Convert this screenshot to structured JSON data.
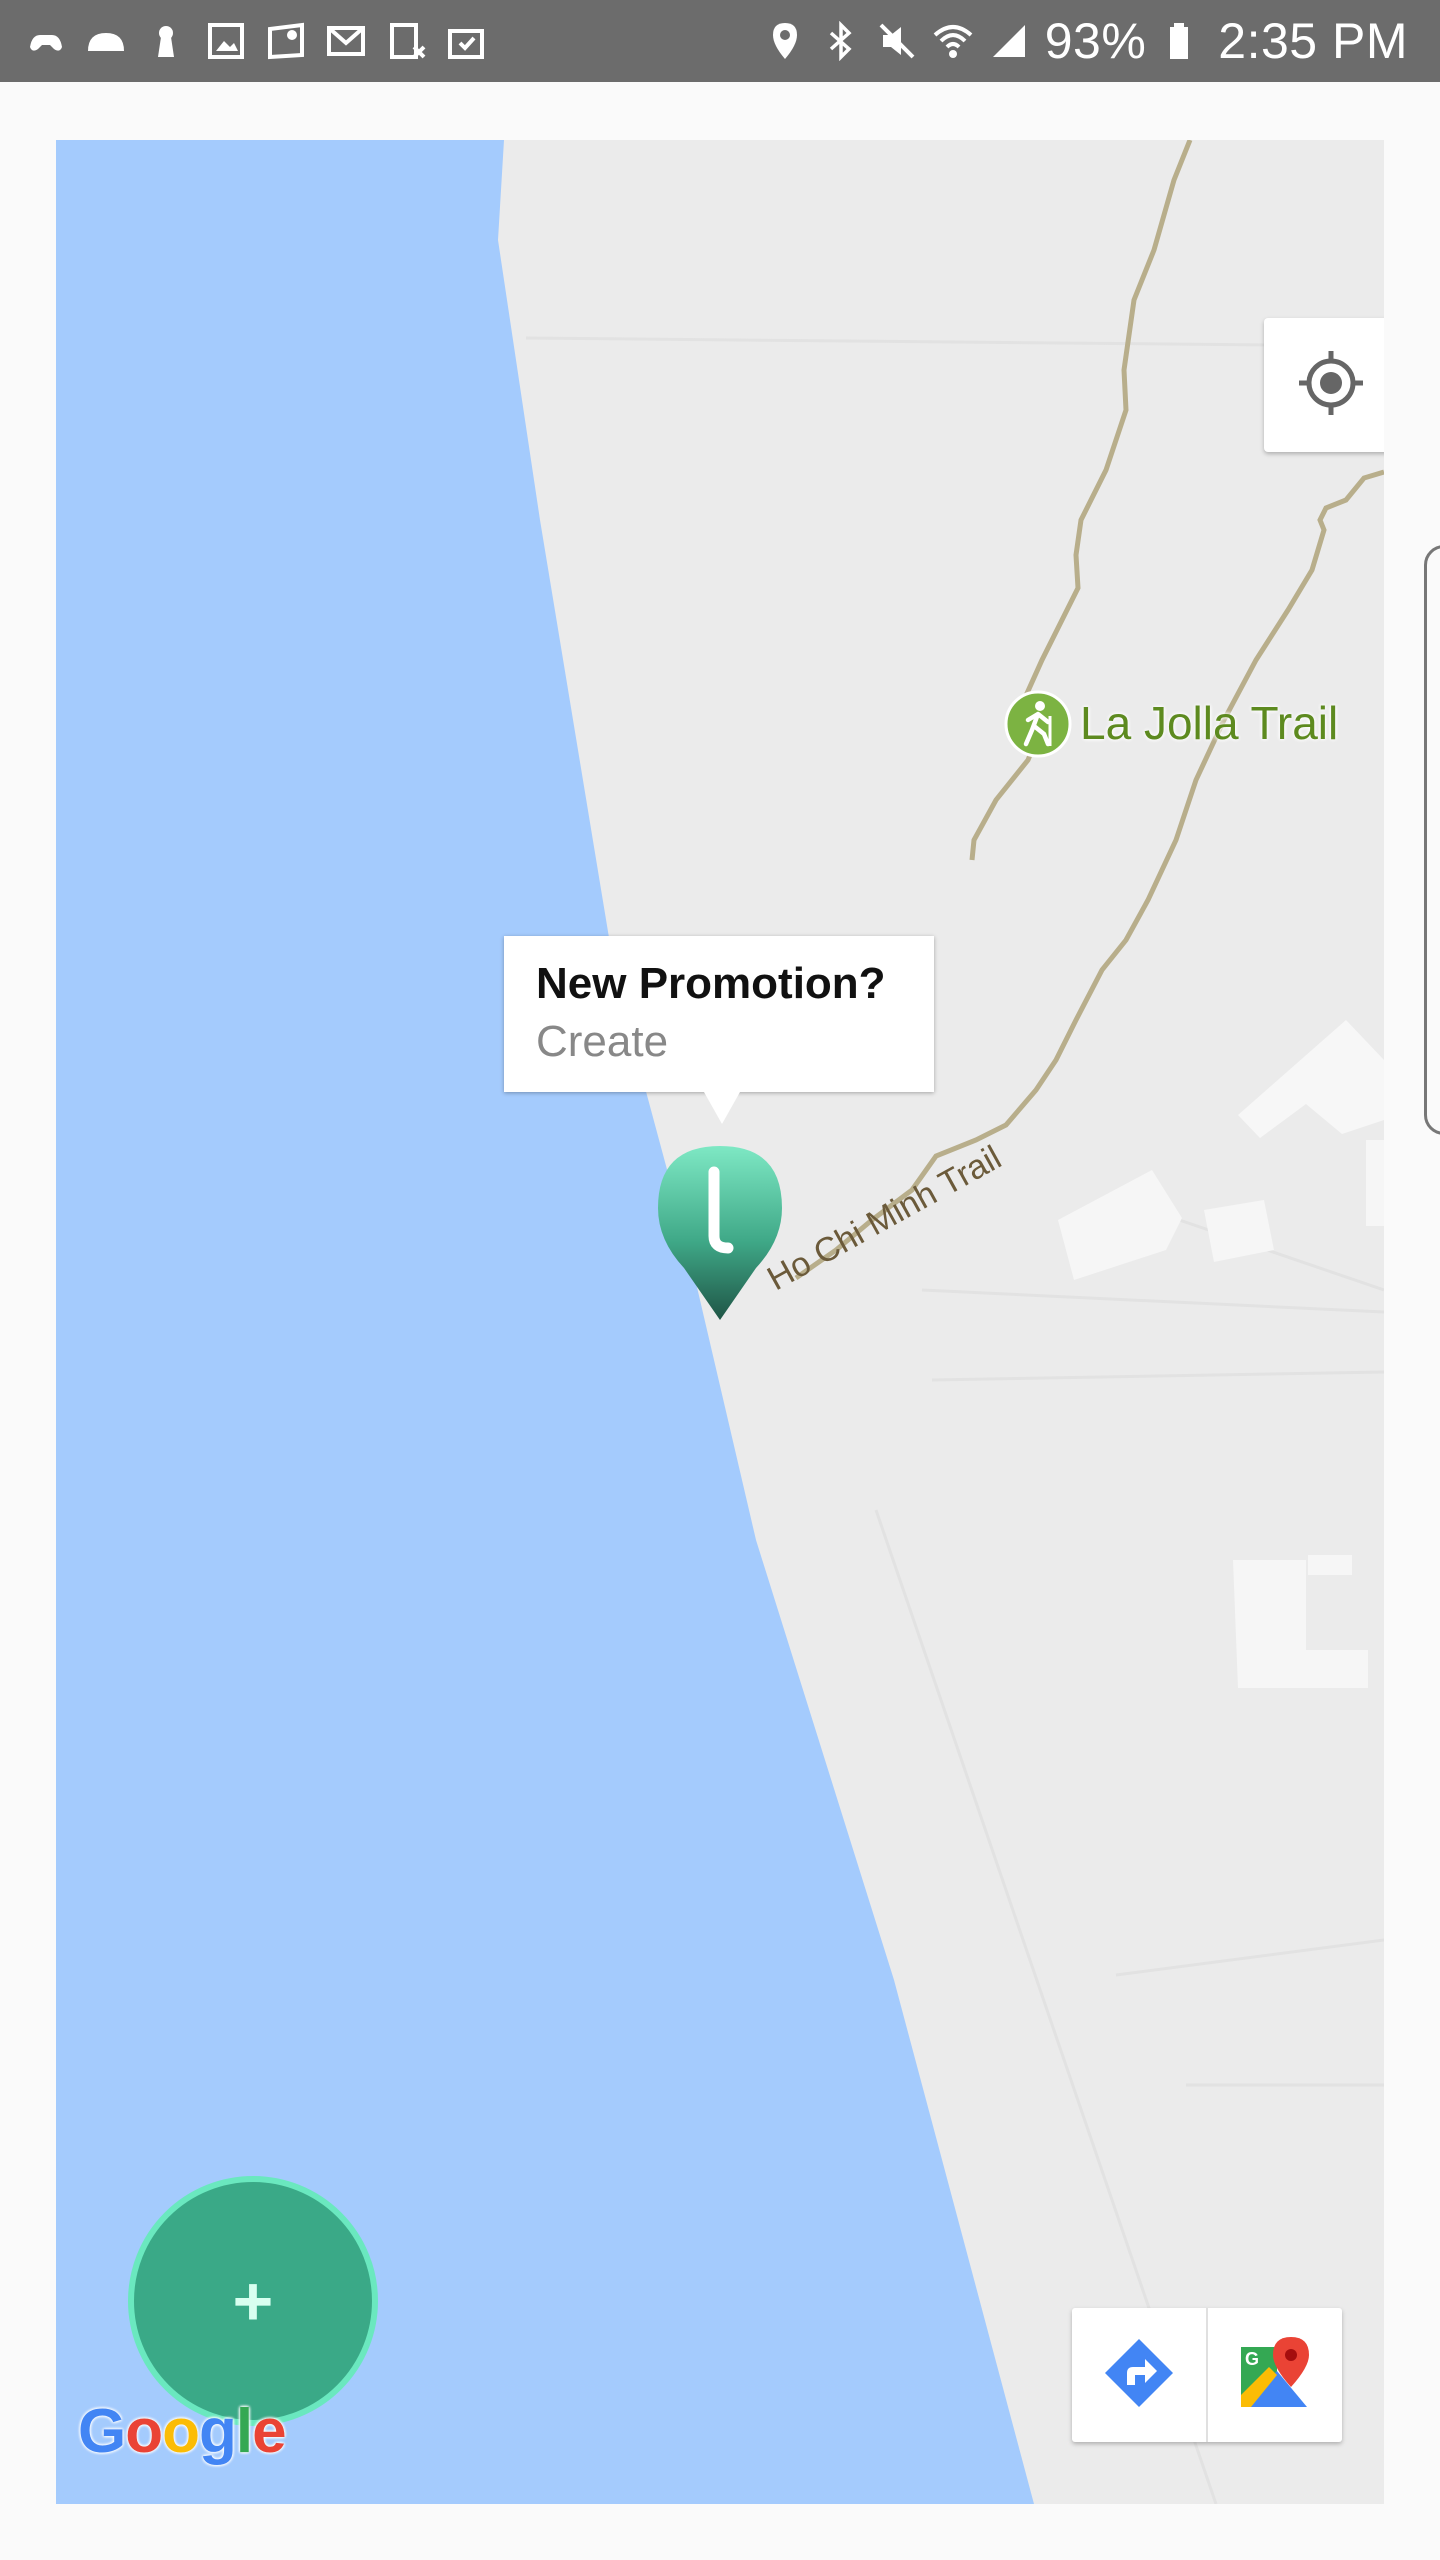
{
  "status_bar": {
    "left_icons": [
      "game-controller-icon",
      "cloud-icon",
      "keyhole-icon",
      "image-icon",
      "maps-icon",
      "gmail-icon",
      "sim-icon",
      "clipboard-icon"
    ],
    "right_icons": [
      "location-icon",
      "bluetooth-icon",
      "mute-icon",
      "wifi-icon",
      "signal-icon"
    ],
    "battery": "93%",
    "time": "2:35 PM"
  },
  "map": {
    "trail_label": "La Jolla Trail",
    "road_label": "Ho Chi Minh Trail",
    "water_color": "#a4cbfd",
    "land_color": "#ebebeb",
    "trail_color": "#b5ab88",
    "attribution": "Google"
  },
  "info_window": {
    "title": "New Promotion?",
    "action": "Create"
  },
  "marker": {
    "letter": "l",
    "color_top": "#7ee8c4",
    "color_bottom": "#1f5546"
  },
  "fab": {
    "label": "+",
    "color": "#3aa987"
  }
}
